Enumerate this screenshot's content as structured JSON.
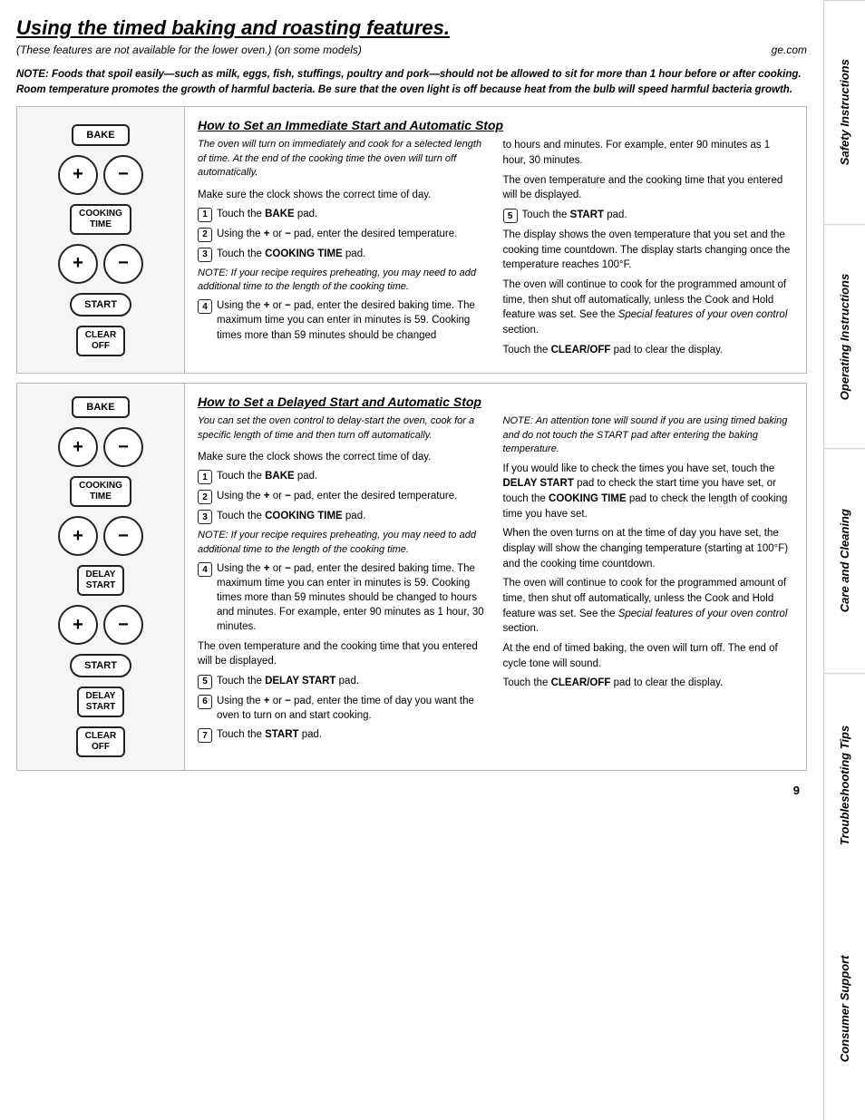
{
  "page": {
    "title": "Using the timed baking and roasting features.",
    "subtitle": "(These features are not available for the lower oven.) (on some models)",
    "ge_com": "ge.com",
    "note": "NOTE: Foods that spoil easily—such as milk, eggs, fish, stuffings, poultry and pork—should not be allowed to sit for more than 1 hour before or after cooking. Room temperature promotes the growth of harmful bacteria. Be sure that the oven light is off because heat from the bulb will speed harmful bacteria growth.",
    "page_number": "9"
  },
  "sidebar": {
    "sections": [
      "Safety Instructions",
      "Operating Instructions",
      "Care and Cleaning",
      "Troubleshooting Tips",
      "Consumer Support"
    ]
  },
  "immediate_section": {
    "heading": "How to Set an Immediate Start and Automatic Stop",
    "intro": "The oven will turn on immediately and cook for a selected length of time. At the end of the cooking time the oven will turn off automatically.",
    "make_sure": "Make sure the clock shows the correct time of day.",
    "steps": [
      {
        "num": "1",
        "text": "Touch the BAKE pad."
      },
      {
        "num": "2",
        "text": "Using the + or − pad, enter the desired temperature."
      },
      {
        "num": "3",
        "text": "Touch the COOKING TIME pad."
      },
      {
        "num": "4",
        "text": "Using the + or − pad, enter the desired baking time. The maximum time you can enter in minutes is 59. Cooking times more than 59 minutes should be changed"
      }
    ],
    "note_step4": "NOTE: If your recipe requires preheating, you may need to add additional time to the length of the cooking time.",
    "right_col": [
      "to hours and minutes. For example, enter 90 minutes as 1 hour, 30 minutes.",
      "The oven temperature and the cooking time that you entered will be displayed."
    ],
    "step5": {
      "num": "5",
      "text": "Touch the START pad."
    },
    "after_step5_1": "The display shows the oven temperature that you set and the cooking time countdown. The display starts changing once the temperature reaches 100°F.",
    "after_step5_2": "The oven will continue to cook for the programmed amount of time, then shut off automatically, unless the Cook and Hold feature was set. See the Special features of your oven control section.",
    "clear_off_text": "Touch the CLEAR/OFF pad to clear the display.",
    "diagram": {
      "buttons": [
        "BAKE",
        "+",
        "−",
        "COOKING TIME",
        "+",
        "−",
        "START",
        "CLEAR OFF"
      ]
    }
  },
  "delayed_section": {
    "heading": "How to Set a Delayed Start and Automatic Stop",
    "intro": "You can set the oven control to delay-start the oven, cook for a specific length of time and then turn off automatically.",
    "make_sure": "Make sure the clock shows the correct time of day.",
    "steps": [
      {
        "num": "1",
        "text": "Touch the BAKE pad."
      },
      {
        "num": "2",
        "text": "Using the + or − pad, enter the desired temperature."
      },
      {
        "num": "3",
        "text": "Touch the COOKING TIME pad."
      },
      {
        "num": "4",
        "text": "Using the + or − pad, enter the desired baking time. The maximum time you can enter in minutes is 59. Cooking times more than 59 minutes should be changed to hours and minutes. For example, enter 90 minutes as 1 hour, 30 minutes."
      }
    ],
    "note_step4": "NOTE: If your recipe requires preheating, you may need to add additional time to the length of the cooking time.",
    "oven_temp_display": "The oven temperature and the cooking time that you entered will be displayed.",
    "step5": {
      "num": "5",
      "text": "Touch the DELAY START pad."
    },
    "step6": {
      "num": "6",
      "text": "Using the + or − pad, enter the time of day you want the oven to turn on and start cooking."
    },
    "step7": {
      "num": "7",
      "text": "Touch the START pad."
    },
    "right_note": "NOTE: An attention tone will sound if you are using timed baking and do not touch the START pad after entering the baking temperature.",
    "right_check": "If you would like to check the times you have set, touch the DELAY START pad to check the start time you have set, or touch the COOKING TIME pad to check the length of cooking time you have set.",
    "right_when": "When the oven turns on at the time of day you have set, the display will show the changing temperature (starting at 100°F) and the cooking time countdown.",
    "right_continue": "The oven will continue to cook for the programmed amount of time, then shut off automatically, unless the Cook and Hold feature was set. See the Special features of your oven control section.",
    "right_end": "At the end of timed baking, the oven will turn off. The end of cycle tone will sound.",
    "clear_off_text": "Touch the CLEAR/OFF pad to clear the display.",
    "diagram": {
      "buttons": [
        "BAKE",
        "+",
        "−",
        "COOKING TIME",
        "+",
        "−",
        "DELAY START",
        "+",
        "−",
        "START",
        "DELAY START",
        "CLEAR OFF"
      ]
    }
  }
}
